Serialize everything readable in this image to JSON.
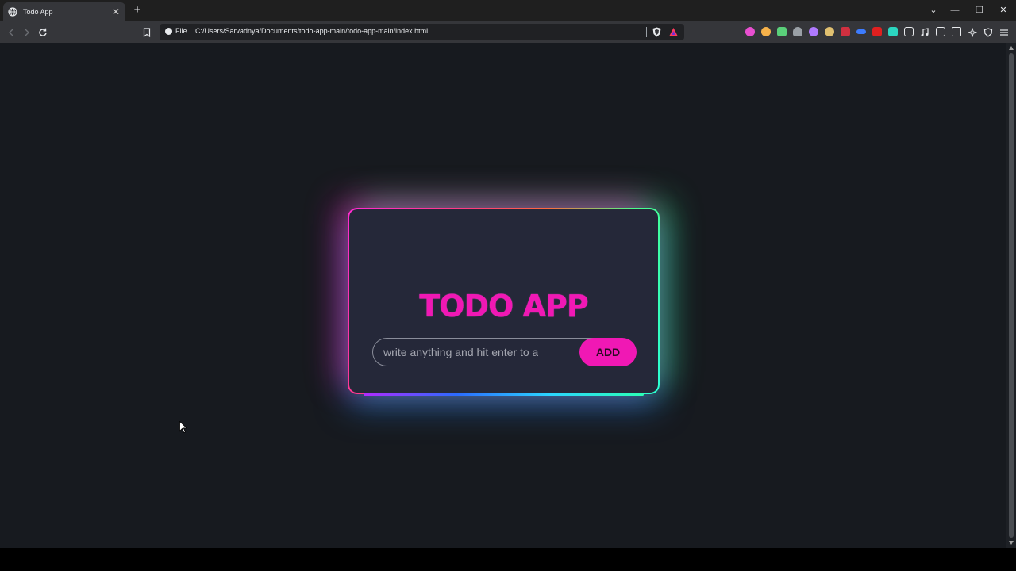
{
  "browser": {
    "tab": {
      "title": "Todo App",
      "close_label": "✕"
    },
    "new_tab_label": "+",
    "window_controls": {
      "tab_search": "⌄",
      "minimize": "—",
      "restore": "❐",
      "close": "✕"
    },
    "omnibox": {
      "scheme_label": "File",
      "url": "C:/Users/Sarvadnya/Documents/todo-app-main/todo-app-main/index.html"
    },
    "extension_icons": [
      "extension-puzzle-icon",
      "media-controls-icon",
      "sidebar-icon",
      "wallet-icon",
      "leo-ai-icon",
      "vpn-icon",
      "menu-icon"
    ]
  },
  "app": {
    "title": "TODO APP",
    "input_placeholder": "write anything and hit enter to add",
    "add_button_label": "ADD"
  },
  "colors": {
    "page_background": "#171a1f",
    "card_background": "#252839",
    "accent": "#f018b4"
  }
}
